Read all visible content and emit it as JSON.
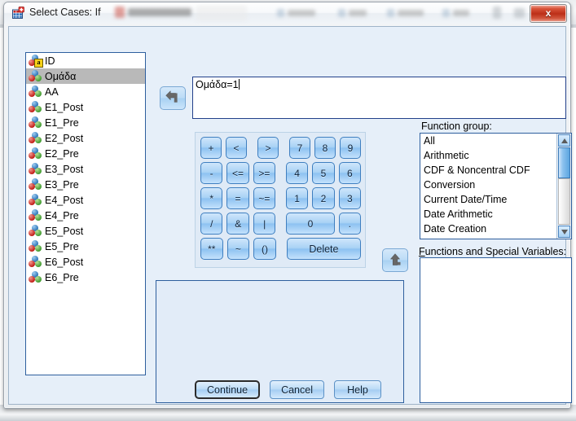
{
  "window": {
    "title": "Select Cases: If",
    "icon": "spss-dialog-icon",
    "close_label": "x"
  },
  "variable_list": {
    "items": [
      {
        "name": "ID",
        "type": "string",
        "selected": false
      },
      {
        "name": "Ομάδα",
        "type": "nominal",
        "selected": true
      },
      {
        "name": "AA",
        "type": "nominal",
        "selected": false
      },
      {
        "name": "E1_Post",
        "type": "nominal",
        "selected": false
      },
      {
        "name": "E1_Pre",
        "type": "nominal",
        "selected": false
      },
      {
        "name": "E2_Post",
        "type": "nominal",
        "selected": false
      },
      {
        "name": "E2_Pre",
        "type": "nominal",
        "selected": false
      },
      {
        "name": "E3_Post",
        "type": "nominal",
        "selected": false
      },
      {
        "name": "E3_Pre",
        "type": "nominal",
        "selected": false
      },
      {
        "name": "E4_Post",
        "type": "nominal",
        "selected": false
      },
      {
        "name": "E4_Pre",
        "type": "nominal",
        "selected": false
      },
      {
        "name": "E5_Post",
        "type": "nominal",
        "selected": false
      },
      {
        "name": "E5_Pre",
        "type": "nominal",
        "selected": false
      },
      {
        "name": "E6_Post",
        "type": "nominal",
        "selected": false
      },
      {
        "name": "E6_Pre",
        "type": "nominal",
        "selected": false
      }
    ]
  },
  "expression": {
    "value": "Ομάδα=1",
    "placeholder": ""
  },
  "transfer_buttons": {
    "insert_variable": "arrow-left-icon",
    "insert_function": "arrow-up-icon"
  },
  "keypad": {
    "rows": [
      [
        {
          "label": "+",
          "style": "w1"
        },
        {
          "label": "<",
          "style": "w1",
          "gap": true
        },
        {
          "label": ">",
          "style": "w1"
        },
        {
          "label": "7",
          "style": "w1",
          "lead_gap": true
        },
        {
          "label": "8",
          "style": "w1"
        },
        {
          "label": "9",
          "style": "w1"
        }
      ],
      [
        {
          "label": "-",
          "style": "w1"
        },
        {
          "label": "<=",
          "style": "w1"
        },
        {
          "label": ">=",
          "style": "w1"
        },
        {
          "label": "4",
          "style": "w1"
        },
        {
          "label": "5",
          "style": "w1"
        },
        {
          "label": "6",
          "style": "w1"
        }
      ],
      [
        {
          "label": "*",
          "style": "w1"
        },
        {
          "label": "=",
          "style": "w1"
        },
        {
          "label": "~=",
          "style": "w1"
        },
        {
          "label": "1",
          "style": "w1"
        },
        {
          "label": "2",
          "style": "w1"
        },
        {
          "label": "3",
          "style": "w1"
        }
      ],
      [
        {
          "label": "/",
          "style": "w1"
        },
        {
          "label": "&",
          "style": "w1"
        },
        {
          "label": "|",
          "style": "w1"
        },
        {
          "label": "0",
          "style": "wide"
        },
        {
          "label": ".",
          "style": "w1"
        }
      ],
      [
        {
          "label": "**",
          "style": "w1"
        },
        {
          "label": "~",
          "style": "w1"
        },
        {
          "label": "()",
          "style": "w1"
        },
        {
          "label": "Delete",
          "style": "del"
        }
      ]
    ]
  },
  "function_group": {
    "label": "Function group:",
    "label_mnemonic": "g",
    "items": [
      "All",
      "Arithmetic",
      "CDF & Noncentral CDF",
      "Conversion",
      "Current Date/Time",
      "Date Arithmetic",
      "Date Creation"
    ],
    "selected": "",
    "scrollbar": {
      "up_icon": "scroll-up-arrow-icon",
      "down_icon": "scroll-down-arrow-icon"
    }
  },
  "functions_and_special_variables": {
    "label": "Functions and Special Variables:",
    "label_mnemonic": "F",
    "items": []
  },
  "buttons": {
    "continue": "Continue",
    "cancel": "Cancel",
    "help": "Help"
  },
  "colors": {
    "dialog_background": "#e6eff9",
    "list_border": "#2e5f9e",
    "selection": "#b9b9b9",
    "button_accent": "#a9d2f5",
    "close_button": "#bc2f18"
  }
}
